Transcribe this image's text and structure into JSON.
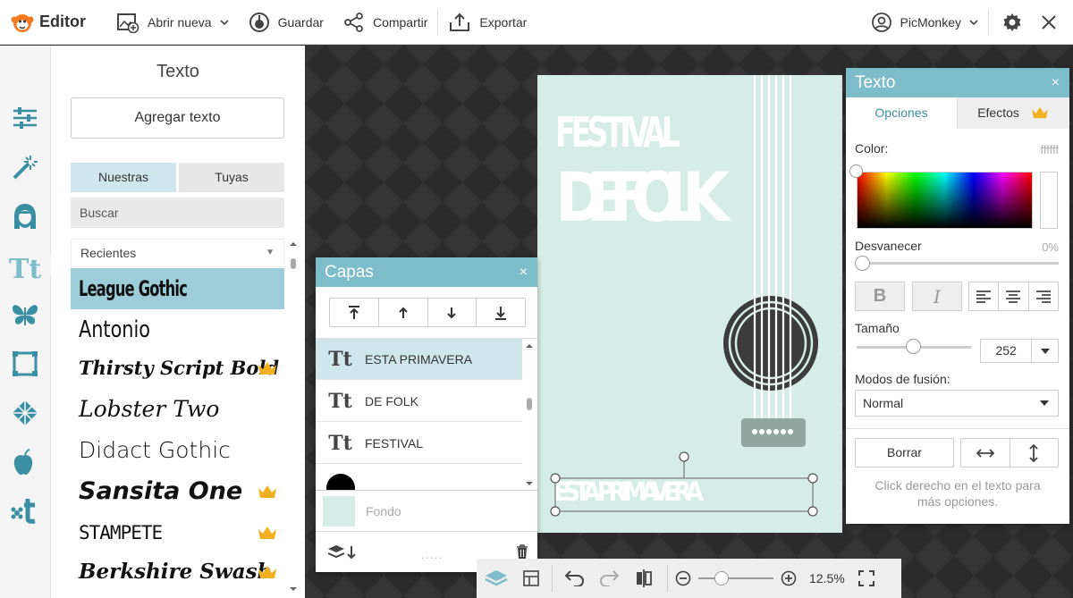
{
  "topbar": {
    "logo_label": "Editor",
    "open_new_label": "Abrir nueva",
    "save_label": "Guardar",
    "share_label": "Compartir",
    "export_label": "Exportar",
    "account_label": "PicMonkey"
  },
  "text_panel": {
    "title": "Texto",
    "add_text_label": "Agregar texto",
    "tabs": [
      "Nuestras",
      "Tuyas"
    ],
    "search_placeholder": "Buscar",
    "filter_selected": "Recientes",
    "fonts": [
      {
        "name": "League Gothic",
        "premium": false,
        "selected": true
      },
      {
        "name": "Antonio",
        "premium": false,
        "selected": false
      },
      {
        "name": "Thirsty Script Bold",
        "premium": true,
        "selected": false
      },
      {
        "name": "Lobster Two",
        "premium": false,
        "selected": false
      },
      {
        "name": "Didact Gothic",
        "premium": false,
        "selected": false
      },
      {
        "name": "Sansita One",
        "premium": true,
        "selected": false
      },
      {
        "name": "STAMPETE",
        "premium": true,
        "selected": false
      },
      {
        "name": "Berkshire Swash",
        "premium": true,
        "selected": false
      }
    ]
  },
  "poster": {
    "line1": "FESTIVAL",
    "line2": "DE FOLK",
    "line3": "ESTA PRIMAVERA",
    "background_color": "#d5ede6",
    "text_color": "#ffffff",
    "guitar_color": "#3c3c3c"
  },
  "layers_panel": {
    "title": "Capas",
    "close_label": "×",
    "layers": [
      {
        "label": "ESTA PRIMAVERA",
        "icon": "Tt",
        "selected": true
      },
      {
        "label": "DE FOLK",
        "icon": "Tt",
        "selected": false
      },
      {
        "label": "FESTIVAL",
        "icon": "Tt",
        "selected": false
      },
      {
        "label": "circle",
        "icon": "circle-shape",
        "selected": false
      }
    ],
    "background_label": "Fondo",
    "footer_dots": "....."
  },
  "text_options": {
    "title": "Texto",
    "close_label": "×",
    "tabs": [
      "Opciones",
      "Efectos"
    ],
    "color_label": "Color:",
    "color_value": "ffffff",
    "fade_label": "Desvanecer",
    "fade_value": "0%",
    "bold_label": "B",
    "italic_label": "I",
    "size_label": "Tamaño",
    "size_value": "252",
    "blend_label": "Modos de fusión:",
    "blend_value": "Normal",
    "clear_label": "Borrar",
    "hint": "Click derecho en el texto para más opciones."
  },
  "bottombar": {
    "zoom": "12.5%"
  },
  "colors": {
    "accent": "#7dbcc9",
    "selected_row": "#cfe7ec",
    "selected_font": "#9ccdd9",
    "crown": "#f2b01e"
  }
}
